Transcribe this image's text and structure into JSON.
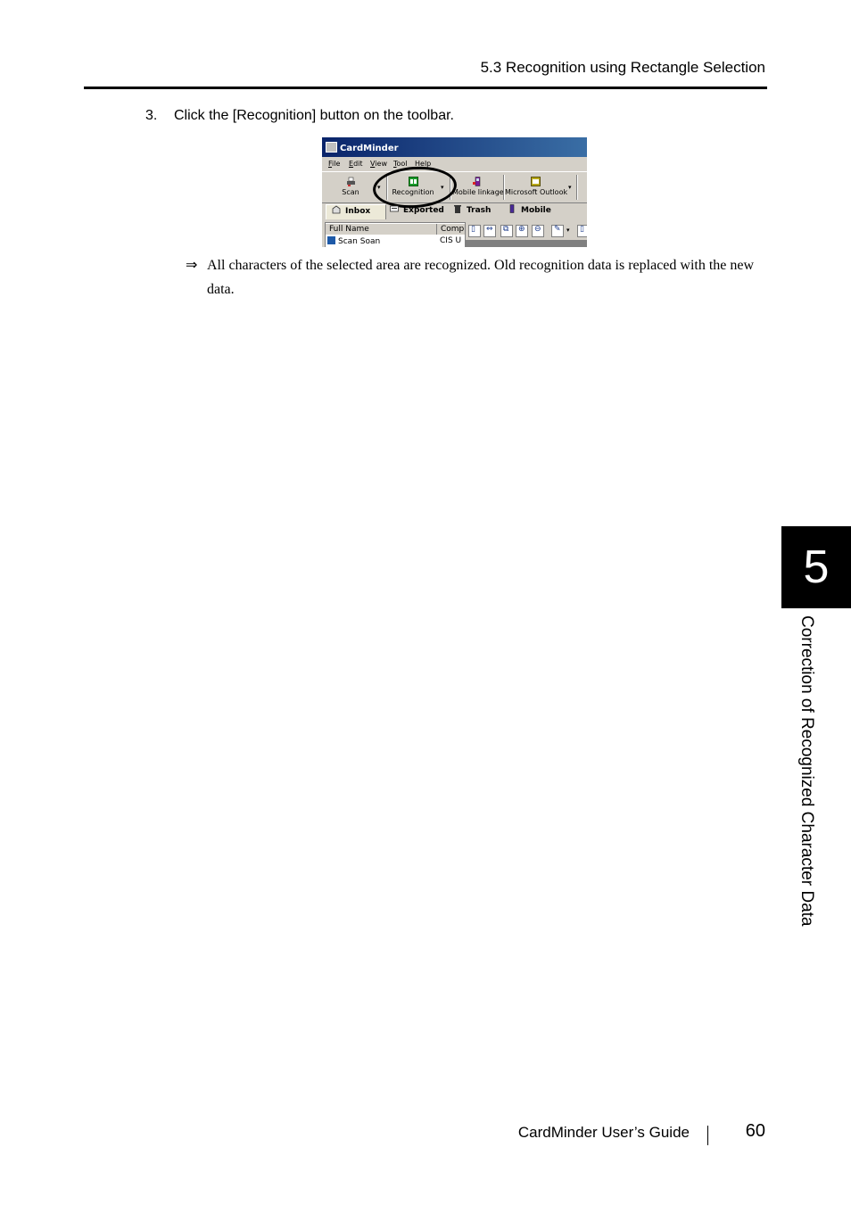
{
  "header": {
    "section_title": "5.3 Recognition using Rectangle Selection"
  },
  "step": {
    "number": "3.",
    "text": "Click the [Recognition] button on the toolbar."
  },
  "screenshot": {
    "window_title": "CardMinder",
    "menu": [
      "File",
      "Edit",
      "View",
      "Tool",
      "Help"
    ],
    "toolbar": {
      "scan": "Scan",
      "recognition": "Recognition",
      "mobile_linkage": "Mobile linkage",
      "microsoft_outlook": "Microsoft Outlook",
      "dropdown_glyph": "▾"
    },
    "tabs": [
      "Inbox",
      "Exported",
      "Trash",
      "Mobile"
    ],
    "list": {
      "columns": [
        "Full Name",
        "Comp"
      ],
      "first_row": [
        "Scan Soan",
        "CIS U"
      ]
    },
    "preview_tool_glyphs": [
      "▯",
      "⇔",
      "⧉",
      "⊕",
      "⊖",
      "✎",
      "▾",
      "▯"
    ]
  },
  "result": {
    "arrow": "⇒",
    "text": "All characters of the selected area are recognized. Old recognition data is replaced with the new data."
  },
  "chapter": {
    "number": "5",
    "title": "Correction of Recognized Character Data"
  },
  "footer": {
    "guide_title": "CardMinder  User’s Guide",
    "page_number": "60"
  }
}
